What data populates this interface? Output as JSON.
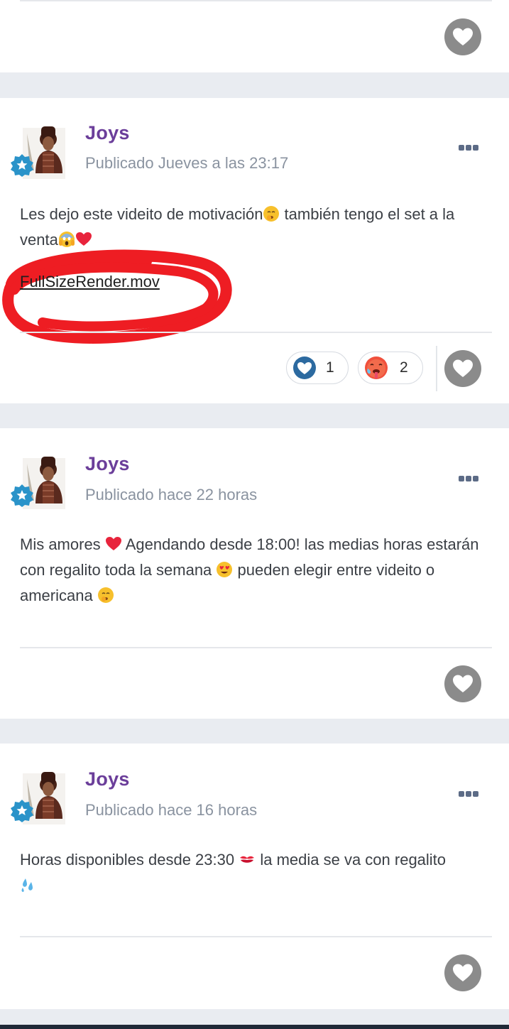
{
  "posts": [
    {
      "author": "Joys",
      "date": "Publicado Jueves a las 23:17",
      "text_part1": "Les dejo este videito de motivación",
      "text_part2": " también tengo el set a la venta",
      "attachment": "FullSizeRender.mov",
      "reactions": [
        {
          "type": "heart-reaction-icon",
          "count": "1"
        },
        {
          "type": "hot-face-emoji",
          "count": "2"
        }
      ]
    },
    {
      "author": "Joys",
      "date": "Publicado hace 22 horas",
      "text_part1": "Mis amores ",
      "text_part2": " Agendando desde 18:00!  las medias horas estarán con regalito toda la semana ",
      "text_part3": " pueden elegir entre videito o americana "
    },
    {
      "author": "Joys",
      "date": "Publicado hace 16 horas",
      "text_part1": "Horas disponibles desde 23:30 ",
      "text_part2": " la media se va con regalito"
    }
  ],
  "colors": {
    "author": "#6b3e9a",
    "date": "#8a93a0",
    "like_button": "#8b8b8b",
    "badge": "#2a93c9",
    "highlight_circle": "#ee1d23",
    "page_background": "#e9ecf1"
  }
}
